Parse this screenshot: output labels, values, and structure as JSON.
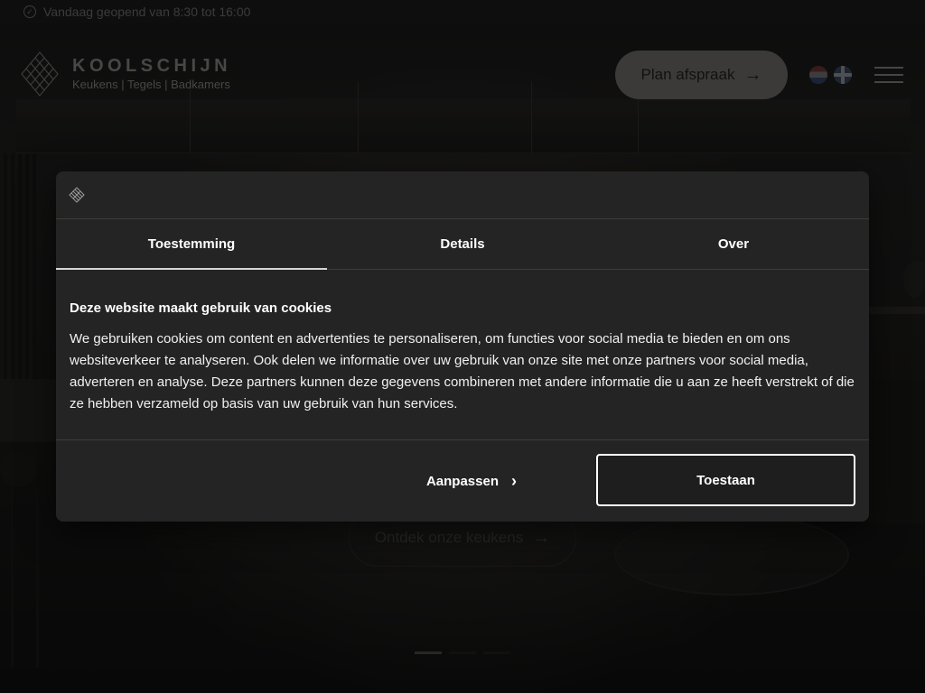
{
  "topbar": {
    "hours_text": "Vandaag geopend van 8:30 tot 16:00"
  },
  "brand": {
    "name": "KOOLSCHIJN",
    "tagline": "Keukens | Tegels | Badkamers"
  },
  "header": {
    "cta_label": "Plan afspraak",
    "languages": [
      "NL",
      "EN"
    ]
  },
  "hero": {
    "cta_label": "Ontdek onze keukens",
    "slides_total": 3,
    "slide_active": 1
  },
  "cookie_dialog": {
    "tabs": [
      {
        "label": "Toestemming",
        "active": true
      },
      {
        "label": "Details",
        "active": false
      },
      {
        "label": "Over",
        "active": false
      }
    ],
    "title": "Deze website maakt gebruik van cookies",
    "body": "We gebruiken cookies om content en advertenties te personaliseren, om functies voor social media te bieden en om ons websiteverkeer te analyseren. Ook delen we informatie over uw gebruik van onze site met onze partners voor social media, adverteren en analyse. Deze partners kunnen deze gegevens combineren met andere informatie die u aan ze heeft verstrekt of die ze hebben verzameld op basis van uw gebruik van hun services.",
    "adjust_label": "Aanpassen",
    "allow_label": "Toestaan"
  },
  "colors": {
    "dialog_bg": "#242424",
    "dialog_text": "#ffffff",
    "page_bg": "#0c0c0c"
  }
}
